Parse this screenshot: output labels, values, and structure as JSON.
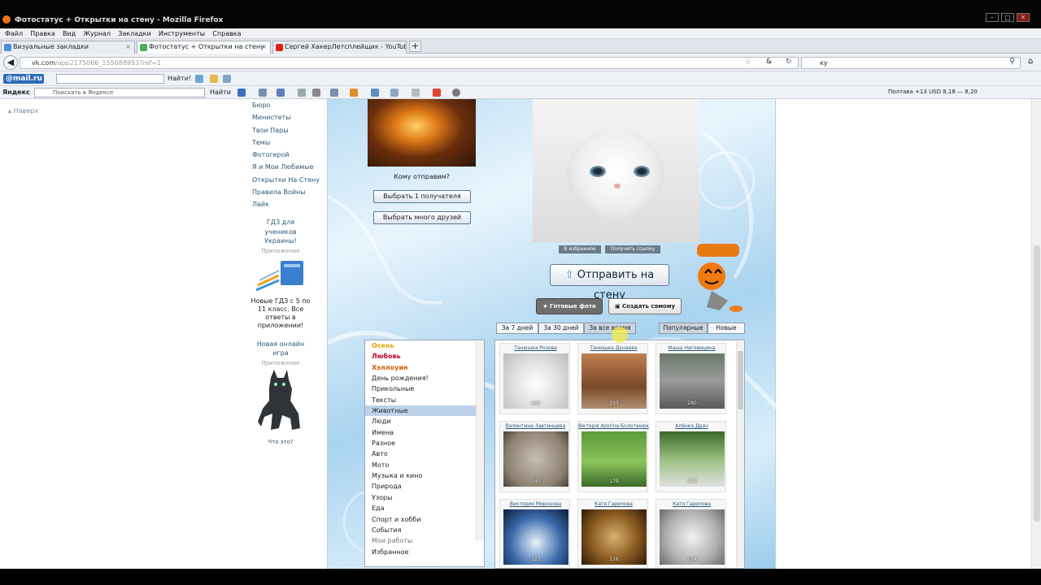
{
  "window": {
    "title": "Фотостатус + Открытки на стену - Mozilla Firefox"
  },
  "menu": [
    "Файл",
    "Правка",
    "Вид",
    "Журнал",
    "Закладки",
    "Инструменты",
    "Справка"
  ],
  "tabs": [
    {
      "label": "Визуальные закладки"
    },
    {
      "label": "Фотостатус + Открытки на стену"
    },
    {
      "label": "Сергей ХакерЛетсплейщик - YouTube"
    }
  ],
  "nav": {
    "url_host": "vk.com",
    "url_path": "/app2175066_155688953?ref=1",
    "search_value": "ку"
  },
  "toolbar1": {
    "brand": "@mail.ru",
    "find": "Найти!"
  },
  "toolbar2": {
    "yandex": "Яндекс",
    "placeholder": "Поискать в Яндексе",
    "find": "Найти",
    "city": "Полтава",
    "temp": "+13",
    "rate": "USD 8,18 — 8,20"
  },
  "page": {
    "back_link": "Наверх",
    "left_menu": [
      "Бюро",
      "Министеты",
      "Твои Пары",
      "Темы",
      "Фотогерой",
      "Я и Мои Любимые",
      "Открытки На Стену",
      "Правила Войны",
      "Лайк"
    ],
    "promo1": {
      "title": "ГДЗ для учеников Украины!",
      "sub": "Приложение",
      "text": "Новые ГДЗ с 5 по 11 класс. Все ответы в приложении!"
    },
    "promo2": {
      "title": "Новая онлайн игра",
      "sub": "Приложение",
      "foot": "Что это?"
    },
    "whom": "Кому отправим?",
    "btn_one": "Выбрать 1 получателя",
    "btn_many": "Выбрать много друзей",
    "tag_fav": "В избранное",
    "tag_link": "Получить ссылку",
    "send_wall": "Отправить на стену",
    "btn_ready": "Готовые фото",
    "btn_create": "Создать самому",
    "periods": [
      "За 7 дней",
      "За 30 дней",
      "За все время"
    ],
    "sort": [
      "Популярные",
      "Новые"
    ],
    "categories": [
      {
        "label": "Осень",
        "color": "#e8a000",
        "bold": true
      },
      {
        "label": "Любовь",
        "color": "#c0002a",
        "bold": true
      },
      {
        "label": "Хэллоуин",
        "color": "#d05a00",
        "bold": true
      },
      {
        "label": "День рождения!"
      },
      {
        "label": "Прикольные"
      },
      {
        "label": "Тексты"
      },
      {
        "label": "Животные",
        "selected": true
      },
      {
        "label": "Люди"
      },
      {
        "label": "Имена"
      },
      {
        "label": "Разное"
      },
      {
        "label": "Авто"
      },
      {
        "label": "Мото"
      },
      {
        "label": "Музыка и кино"
      },
      {
        "label": "Природа"
      },
      {
        "label": "Узоры"
      },
      {
        "label": "Еда"
      },
      {
        "label": "Спорт и хобби"
      },
      {
        "label": "События"
      },
      {
        "label": "Мои работы",
        "color": "#777"
      },
      {
        "label": "Избранное"
      }
    ],
    "cards": [
      {
        "name": "Танюшка Розова",
        "count": "442"
      },
      {
        "name": "Танюшка Дунаева",
        "count": "333"
      },
      {
        "name": "Маша Наговицина",
        "count": "280"
      },
      {
        "name": "Валентина Завтинцева",
        "count": "240"
      },
      {
        "name": "Вікторія Azerina Болотенюк",
        "count": "179"
      },
      {
        "name": "Алёнка Драч",
        "count": "172"
      },
      {
        "name": "Виктория Миронова",
        "count": "122"
      },
      {
        "name": "Катя Гарипова",
        "count": "116"
      },
      {
        "name": "Катя Гарипова",
        "count": "114"
      }
    ]
  }
}
